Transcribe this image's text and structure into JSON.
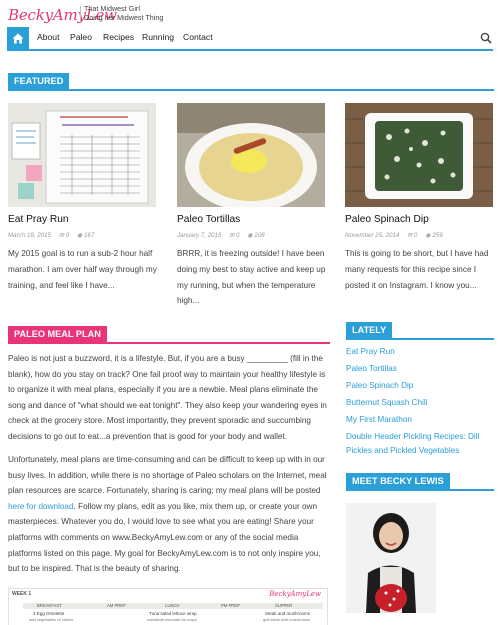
{
  "header": {
    "logo": "BeckyAmyLew",
    "tagline_line1": "That Midwest Girl",
    "tagline_line2": "Doing her Midwest Thing"
  },
  "nav": {
    "items": [
      "About",
      "Paleo",
      "Recipes",
      "Running",
      "Contact"
    ],
    "home_icon": "home-icon",
    "search_icon": "search-icon"
  },
  "colors": {
    "accent_blue": "#2a9fd8",
    "accent_pink": "#e8357a"
  },
  "featured": {
    "label": "FEATURED",
    "posts": [
      {
        "title": "Eat Pray Run",
        "date": "March 18, 2015",
        "comments": "0",
        "views": "167",
        "excerpt": "My 2015 goal is to run a sub-2 hour half marathon. I am over half way through my training, and feel like I have..."
      },
      {
        "title": "Paleo Tortillas",
        "date": "January 7, 2015",
        "comments": "0",
        "views": "208",
        "excerpt": "BRRR, it is freezing outside! I have been doing my best to stay active and keep up my running, but when the temperature high..."
      },
      {
        "title": "Paleo Spinach Dip",
        "date": "November 25, 2014",
        "comments": "0",
        "views": "259",
        "excerpt": "This is going to be short, but I have had many requests for this recipe since I posted it on Instagram. I know you..."
      }
    ]
  },
  "meal_plan": {
    "label": "PALEO MEAL PLAN",
    "para1": "Paleo is not just a buzzword, it is a lifestyle. But, if you are a busy _________ (fill in the blank), how do you stay on track? One fail proof way to maintain your healthy lifestyle is to organize it with meal plans, especially if you are a newbie. Meal plans eliminate the song and dance of \"what should we eat tonight\". They also keep your wandering eyes in check at the grocery store. Most importantly, they prevent sporadic and succumbing decisions to go out to eat...a prevention that is good for your body and wallet.",
    "para2_before_link": "Unfortunately, meal plans are time-consuming and can be difficult to keep up with in our busy lives. In addition, while there is no shortage of Paleo scholars on the Internet, meal plan resources are scarce. Fortunately, sharing is caring; my meal plans will be posted ",
    "para2_link": "here for download",
    "para2_after_link": ". Follow my plans, edit as you like, mix them up, or create your own masterpieces. Whatever you do, I would love to see what you are eating! Share your platforms with comments on www.BeckyAmyLew.com or any of the social media platforms listed on this page. My goal for BeckyAmyLew.com is to not only inspire you, but to be inspired. That is the beauty of sharing.",
    "sheet_week": "WEEK 1",
    "sheet_cols": [
      "BREAKFAST",
      "AM PREP",
      "LUNCH",
      "PM PREP",
      "SUPPER"
    ],
    "sheet_row1": [
      "3 Egg Omelette",
      "Tuna salad lettuce wrap",
      "Steak and mushrooms"
    ],
    "sheet_row2": [
      "add vegetables of choice",
      "substitute avocado for mayo",
      "grill steak with mushrooms"
    ],
    "sheet_logo": "BeckyAmyLew"
  },
  "sidebar": {
    "lately_label": "LATELY",
    "lately_items": [
      "Eat Pray Run",
      "Paleo Tortillas",
      "Paleo Spinach Dip",
      "Butternut Squash Chili",
      "My First Marathon",
      "Double Header Pickling Recipes: Dill Pickles and Pickled Vegetables"
    ],
    "meet_label": "MEET BECKY LEWIS"
  }
}
